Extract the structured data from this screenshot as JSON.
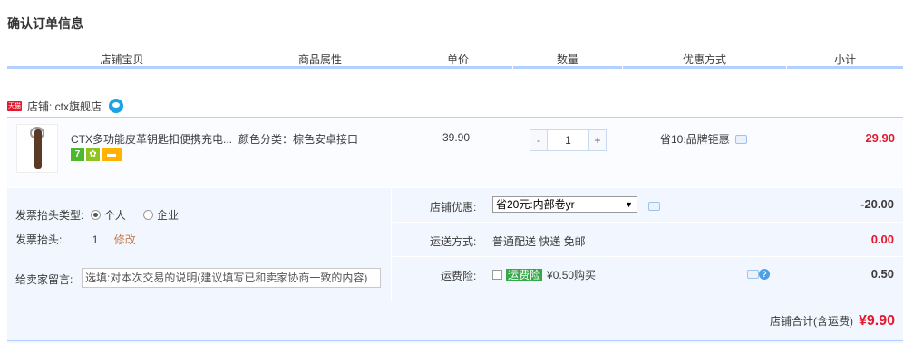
{
  "page": {
    "title": "确认订单信息"
  },
  "header": {
    "col_shop_item": "店铺宝贝",
    "col_attributes": "商品属性",
    "col_price": "单价",
    "col_quantity": "数量",
    "col_promo": "优惠方式",
    "col_subtotal": "小计"
  },
  "shop": {
    "badge": "天猫",
    "name": "店铺: ctx旗舰店"
  },
  "item": {
    "name": "CTX多功能皮革钥匙扣便携充电...",
    "badges": [
      "7",
      "",
      ""
    ],
    "attribute": "颜色分类：棕色安卓接口",
    "price": "39.90",
    "qty_minus": "-",
    "quantity": "1",
    "qty_plus": "+",
    "promo": "省10:品牌钜惠",
    "subtotal": "29.90"
  },
  "invoice": {
    "type_label": "发票抬头类型:",
    "type_personal": "个人",
    "type_company": "企业",
    "selected": "个人",
    "title_label": "发票抬头:",
    "title_value": "1",
    "edit_link": "修改"
  },
  "message": {
    "label": "给卖家留言:",
    "placeholder": "选填:对本次交易的说明(建议填写已和卖家协商一致的内容)"
  },
  "shop_discount": {
    "label": "店铺优惠:",
    "selected": "省20元:内部卷yr",
    "amount": "-20.00"
  },
  "shipping": {
    "label": "运送方式:",
    "value": "普通配送 快递 免邮",
    "amount": "0.00"
  },
  "insurance": {
    "label": "运费险:",
    "badge": "运费险",
    "price_text": "¥0.50购买",
    "amount": "0.50",
    "help": "?"
  },
  "total": {
    "label": "店铺合计(含运费)",
    "amount": "¥9.90"
  },
  "colors": {
    "accent_red": "#e4182e",
    "header_line": "#b2d1ff",
    "panel_bg": "#f2f7ff",
    "insurance_green": "#35a849"
  }
}
